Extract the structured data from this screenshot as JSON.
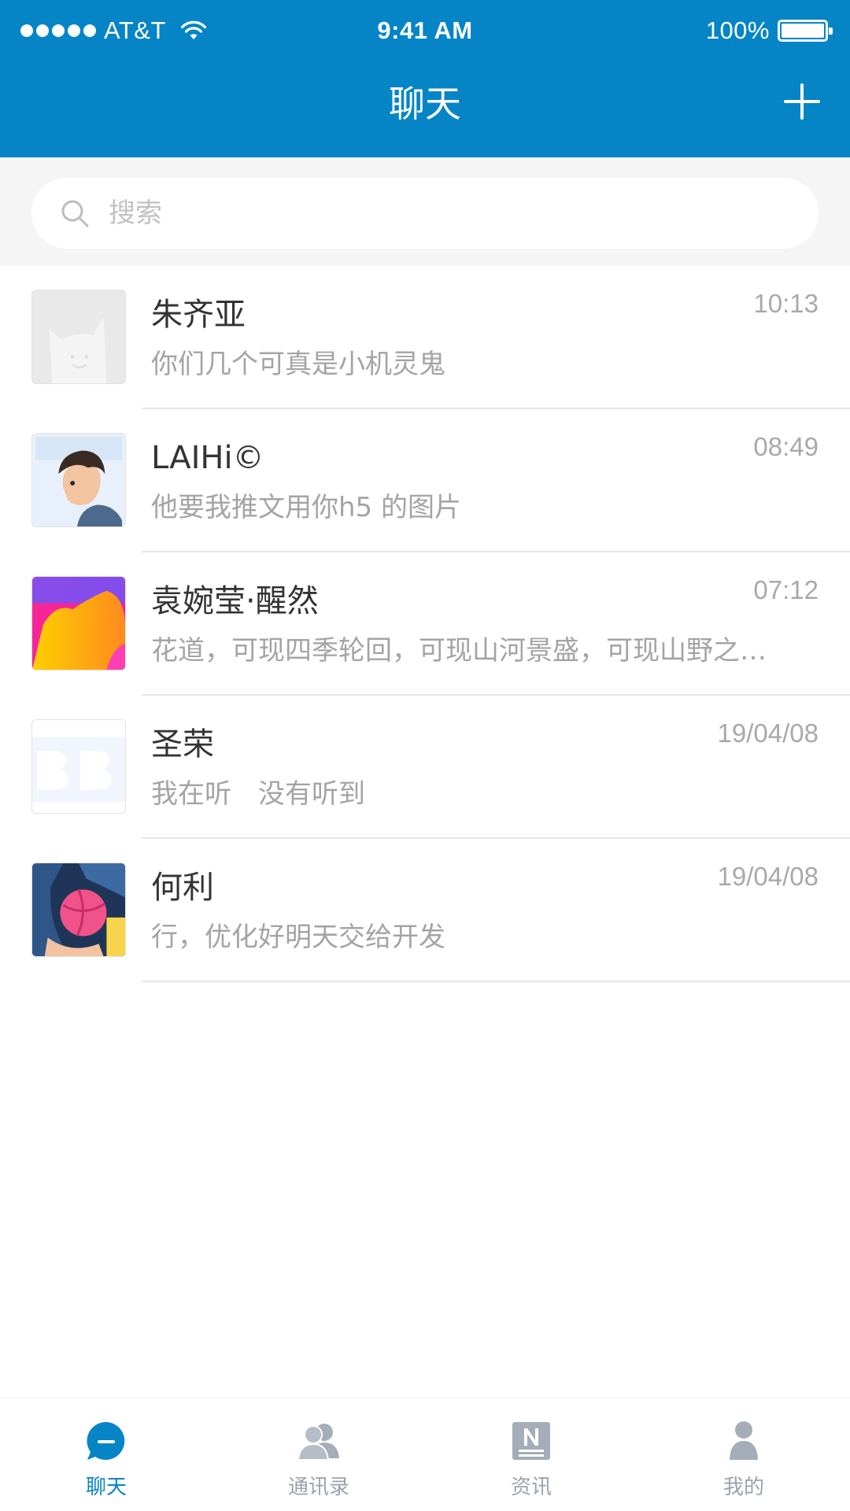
{
  "status_bar": {
    "carrier": "AT&T",
    "time": "9:41 AM",
    "battery": "100%"
  },
  "header": {
    "title": "聊天",
    "add_icon": "plus-icon"
  },
  "search": {
    "placeholder": "搜索",
    "value": "",
    "icon": "search-icon"
  },
  "chats": [
    {
      "name": "朱齐亚",
      "time": "10:13",
      "preview": "你们几个可真是小机灵鬼",
      "avatar": "cat-placeholder-avatar"
    },
    {
      "name": "LAIHi©",
      "time": "08:49",
      "preview": "他要我推文用你h5 的图片",
      "avatar": "cartoon-boy-avatar"
    },
    {
      "name": "袁婉莹·醒然",
      "time": "07:12",
      "preview": "花道，可现四季轮回，可现山河景盛，可现山野之…",
      "avatar": "colorful-gradient-avatar"
    },
    {
      "name": "圣荣",
      "time": "19/04/08",
      "preview": "我在听　没有听到",
      "avatar": "bb-logo-avatar"
    },
    {
      "name": "何利",
      "time": "19/04/08",
      "preview": "行，优化好明天交给开发",
      "avatar": "basketball-illustration-avatar"
    }
  ],
  "tabs": [
    {
      "label": "聊天",
      "icon": "chat-bubble-icon",
      "active": true
    },
    {
      "label": "通讯录",
      "icon": "contacts-icon",
      "active": false
    },
    {
      "label": "资讯",
      "icon": "news-icon",
      "active": false
    },
    {
      "label": "我的",
      "icon": "person-icon",
      "active": false
    }
  ],
  "colors": {
    "brand": "#0585c6",
    "inactive_tab": "#9aa3ad",
    "secondary_text": "#a4a4a4"
  }
}
